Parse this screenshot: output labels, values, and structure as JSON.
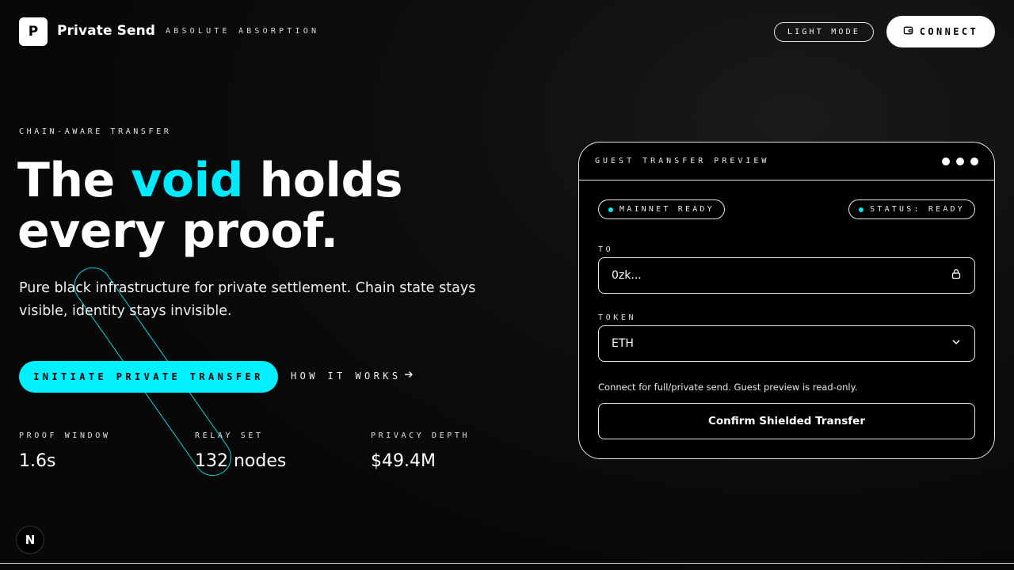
{
  "header": {
    "logo_letter": "P",
    "brand": "Private Send",
    "tagline": "ABSOLUTE ABSORPTION",
    "theme_toggle_label": "LIGHT MODE",
    "connect_label": "CONNECT"
  },
  "hero": {
    "eyebrow": "CHAIN-AWARE TRANSFER",
    "headline_before": "The ",
    "headline_accent": "void",
    "headline_after": " holds every proof.",
    "subtext": "Pure black infrastructure for private settlement. Chain state stays visible, identity stays invisible.",
    "primary_cta": "INITIATE PRIVATE TRANSFER",
    "secondary_cta": "HOW IT WORKS",
    "stats": [
      {
        "label": "PROOF WINDOW",
        "value": "1.6s"
      },
      {
        "label": "RELAY SET",
        "value": "132 nodes"
      },
      {
        "label": "PRIVACY DEPTH",
        "value": "$49.4M"
      }
    ]
  },
  "card": {
    "title": "GUEST TRANSFER PREVIEW",
    "network_pill": "MAINNET READY",
    "status_pill": "STATUS: READY",
    "to_label": "TO",
    "to_value": "0zk...",
    "token_label": "TOKEN",
    "token_value": "ETH",
    "hint": "Connect for full/private send. Guest preview is read-only.",
    "confirm_label": "Confirm Shielded Transfer"
  },
  "floating_badge": "N",
  "colors": {
    "accent": "#00eaff",
    "background": "#0a0a0a",
    "foreground": "#ffffff"
  },
  "icons": {
    "connect": "wallet-icon",
    "how_it_works": "arrow-right-icon",
    "to_field": "lock-icon",
    "token_field": "chevron-down-icon"
  }
}
